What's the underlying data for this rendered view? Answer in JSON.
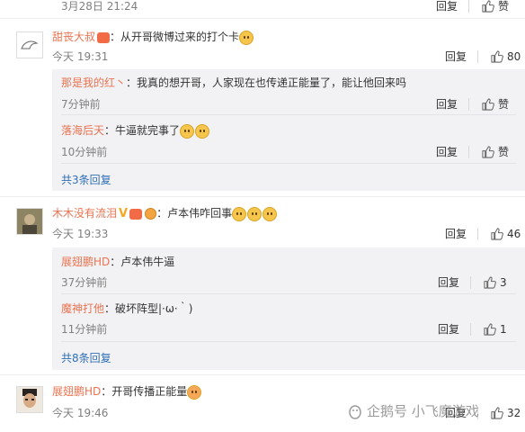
{
  "top_comment": {
    "time": "3月28日 21:24",
    "reply": "回复",
    "like_label": "赞"
  },
  "comments": [
    {
      "author": "甜丧大叔",
      "text": "：从开哥微博过来的打个卡",
      "time": "今天 19:31",
      "reply": "回复",
      "likes": "80",
      "replies": [
        {
          "author": "那是我的红丶",
          "text": "：我真的想开哥，人家现在也传递正能量了，能让他回来吗",
          "time": "7分钟前",
          "reply": "回复",
          "likes": "赞"
        },
        {
          "author": "落海后天",
          "text": "：牛逼就完事了",
          "time": "10分钟前",
          "reply": "回复",
          "likes": "赞"
        }
      ],
      "more": "共3条回复"
    },
    {
      "author": "木木没有流泪",
      "text": "：卢本伟咋回事",
      "time": "今天 19:33",
      "reply": "回复",
      "likes": "46",
      "replies": [
        {
          "author": "展翅鹏HD",
          "text": "：卢本伟牛逼",
          "time": "37分钟前",
          "reply": "回复",
          "likes": "3"
        },
        {
          "author": "魔神打他",
          "text": "：破坏阵型|·ω·｀)",
          "time": "11分钟前",
          "reply": "回复",
          "likes": "1"
        }
      ],
      "more": "共8条回复"
    },
    {
      "author": "展翅鹏HD",
      "text": "：开哥传播正能量",
      "time": "今天 19:46",
      "reply": "回复",
      "likes": "32"
    }
  ],
  "watermark": "企鹅号 小飞魔游戏",
  "colors": {
    "name": "#eb7350",
    "sub_bg": "#f2f2f5",
    "link": "#2f6fb6"
  }
}
